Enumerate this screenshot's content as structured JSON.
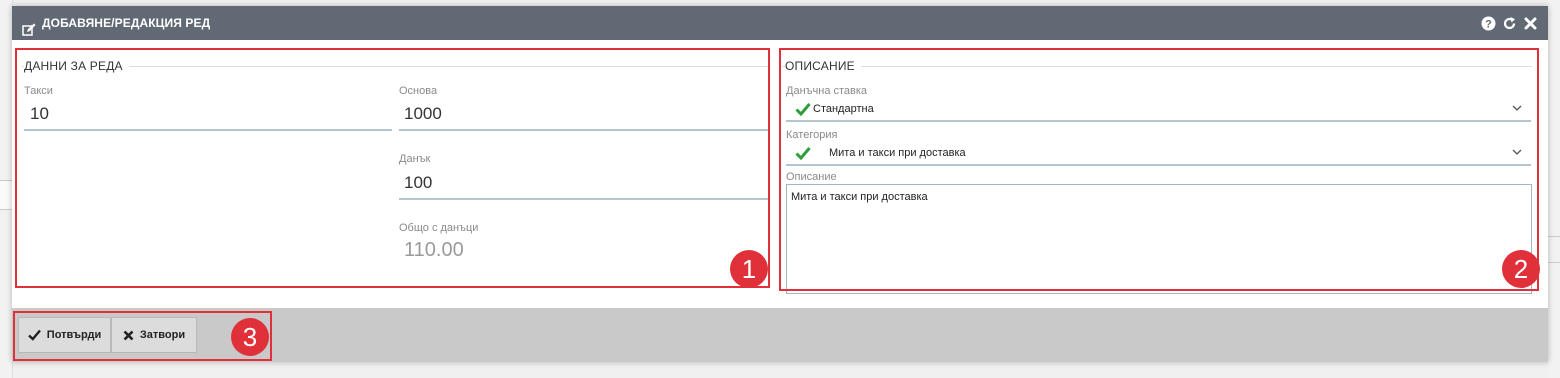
{
  "dialog": {
    "title": "ДОБАВЯНЕ/РЕДАКЦИЯ РЕД",
    "actions": [
      "help-icon",
      "refresh-icon",
      "close-icon"
    ]
  },
  "line_data": {
    "legend": "ДАННИ ЗА РЕДА",
    "taxes_label": "Такси",
    "taxes_value": "10",
    "base_label": "Основа",
    "base_value": "1000",
    "tax_label": "Данък",
    "tax_value": "100",
    "total_label": "Общо с данъци",
    "total_value": "110.00"
  },
  "description": {
    "legend": "ОПИСАНИЕ",
    "tax_rate_label": "Данъчна ставка",
    "tax_rate_value": "Стандартна",
    "category_label": "Категория",
    "category_value": "Мита и такси при доставка",
    "desc_label": "Описание",
    "desc_value": "Мита и такси при доставка"
  },
  "footer": {
    "confirm_label": "Потвърди",
    "close_label": "Затвори"
  },
  "annotations": {
    "badge1": "1",
    "badge2": "2",
    "badge3": "3"
  },
  "colors": {
    "titlebar": "#616975",
    "accent_red": "#e0313a",
    "check_green": "#2e9e3a"
  }
}
